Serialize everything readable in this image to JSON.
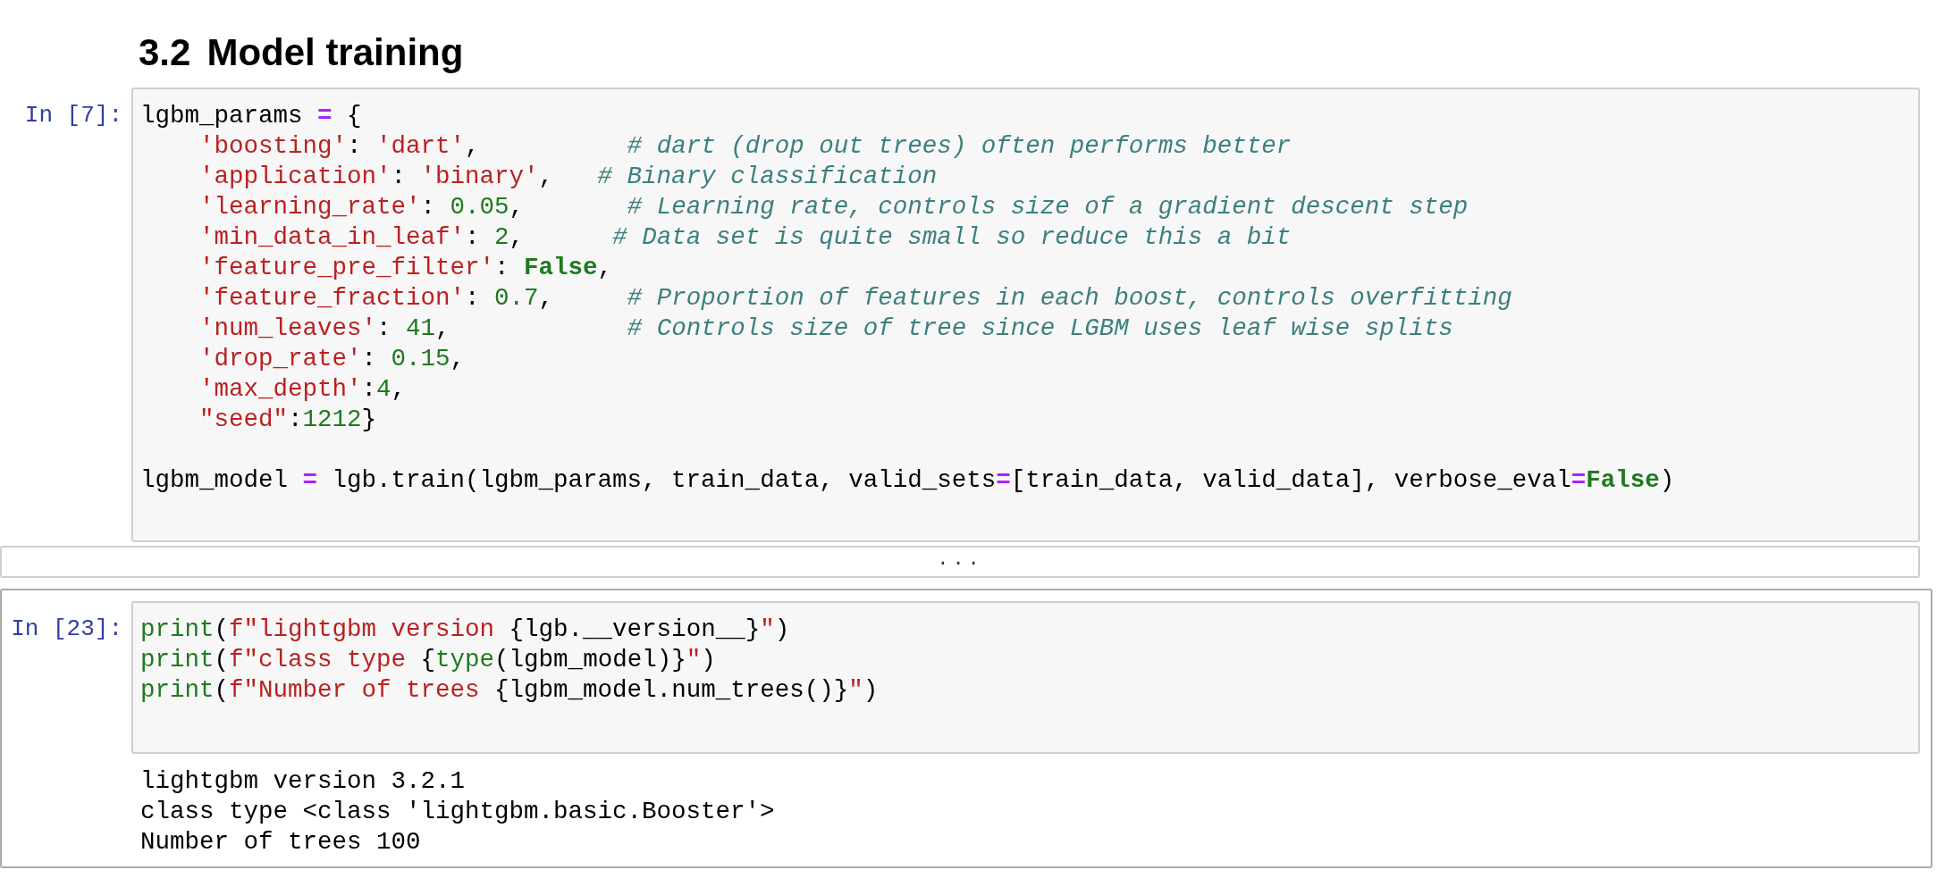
{
  "heading": {
    "number": "3.2",
    "title": "Model training"
  },
  "cells": [
    {
      "prompt": "In [7]:",
      "selected": false,
      "blocks": [
        [
          [
            {
              "t": "lgbm_params ",
              "kind": "plain"
            },
            {
              "t": "=",
              "kind": "op"
            },
            {
              "t": " {",
              "kind": "plain"
            }
          ],
          [
            {
              "t": "    'boosting'",
              "kind": "str"
            },
            {
              "t": ": ",
              "kind": "plain"
            },
            {
              "t": "'dart'",
              "kind": "str"
            },
            {
              "t": ",          ",
              "kind": "plain"
            },
            {
              "t": "# dart (drop out trees) often performs better",
              "kind": "comment"
            }
          ],
          [
            {
              "t": "    'application'",
              "kind": "str"
            },
            {
              "t": ": ",
              "kind": "plain"
            },
            {
              "t": "'binary'",
              "kind": "str"
            },
            {
              "t": ",   ",
              "kind": "plain"
            },
            {
              "t": "# Binary classification",
              "kind": "comment"
            }
          ],
          [
            {
              "t": "    'learning_rate'",
              "kind": "str"
            },
            {
              "t": ": ",
              "kind": "plain"
            },
            {
              "t": "0.05",
              "kind": "num"
            },
            {
              "t": ",       ",
              "kind": "plain"
            },
            {
              "t": "# Learning rate, controls size of a gradient descent step",
              "kind": "comment"
            }
          ],
          [
            {
              "t": "    'min_data_in_leaf'",
              "kind": "str"
            },
            {
              "t": ": ",
              "kind": "plain"
            },
            {
              "t": "2",
              "kind": "num"
            },
            {
              "t": ",      ",
              "kind": "plain"
            },
            {
              "t": "# Data set is quite small so reduce this a bit",
              "kind": "comment"
            }
          ],
          [
            {
              "t": "    'feature_pre_filter'",
              "kind": "str"
            },
            {
              "t": ": ",
              "kind": "plain"
            },
            {
              "t": "False",
              "kind": "kw"
            },
            {
              "t": ",",
              "kind": "plain"
            }
          ],
          [
            {
              "t": "    'feature_fraction'",
              "kind": "str"
            },
            {
              "t": ": ",
              "kind": "plain"
            },
            {
              "t": "0.7",
              "kind": "num"
            },
            {
              "t": ",     ",
              "kind": "plain"
            },
            {
              "t": "# Proportion of features in each boost, controls overfitting",
              "kind": "comment"
            }
          ],
          [
            {
              "t": "    'num_leaves'",
              "kind": "str"
            },
            {
              "t": ": ",
              "kind": "plain"
            },
            {
              "t": "41",
              "kind": "num"
            },
            {
              "t": ",            ",
              "kind": "plain"
            },
            {
              "t": "# Controls size of tree since LGBM uses leaf wise splits",
              "kind": "comment"
            }
          ],
          [
            {
              "t": "    'drop_rate'",
              "kind": "str"
            },
            {
              "t": ": ",
              "kind": "plain"
            },
            {
              "t": "0.15",
              "kind": "num"
            },
            {
              "t": ",",
              "kind": "plain"
            }
          ],
          [
            {
              "t": "    'max_depth'",
              "kind": "str"
            },
            {
              "t": ":",
              "kind": "plain"
            },
            {
              "t": "4",
              "kind": "num"
            },
            {
              "t": ",",
              "kind": "plain"
            }
          ],
          [
            {
              "t": "    \"seed\"",
              "kind": "str"
            },
            {
              "t": ":",
              "kind": "plain"
            },
            {
              "t": "1212",
              "kind": "num"
            },
            {
              "t": "}",
              "kind": "plain"
            }
          ]
        ],
        [
          [
            {
              "t": "lgbm_model ",
              "kind": "plain"
            },
            {
              "t": "=",
              "kind": "op"
            },
            {
              "t": " lgb.train(lgbm_params, train_data, valid_sets",
              "kind": "plain"
            },
            {
              "t": "=",
              "kind": "op"
            },
            {
              "t": "[train_data, valid_data], verbose_eval",
              "kind": "plain"
            },
            {
              "t": "=",
              "kind": "op"
            },
            {
              "t": "False",
              "kind": "kw"
            },
            {
              "t": ")",
              "kind": "plain"
            }
          ]
        ]
      ],
      "collapsed_output": "..."
    },
    {
      "prompt": "In [23]:",
      "selected": true,
      "blocks": [
        [
          [
            {
              "t": "print",
              "kind": "builtin"
            },
            {
              "t": "(",
              "kind": "plain"
            },
            {
              "t": "f\"lightgbm version ",
              "kind": "str"
            },
            {
              "t": "{lgb.__version__}",
              "kind": "plain"
            },
            {
              "t": "\"",
              "kind": "str"
            },
            {
              "t": ")",
              "kind": "plain"
            }
          ],
          [
            {
              "t": "print",
              "kind": "builtin"
            },
            {
              "t": "(",
              "kind": "plain"
            },
            {
              "t": "f\"class type ",
              "kind": "str"
            },
            {
              "t": "{",
              "kind": "plain"
            },
            {
              "t": "type",
              "kind": "builtin"
            },
            {
              "t": "(lgbm_model)}",
              "kind": "plain"
            },
            {
              "t": "\"",
              "kind": "str"
            },
            {
              "t": ")",
              "kind": "plain"
            }
          ],
          [
            {
              "t": "print",
              "kind": "builtin"
            },
            {
              "t": "(",
              "kind": "plain"
            },
            {
              "t": "f\"Number of trees ",
              "kind": "str"
            },
            {
              "t": "{lgbm_model.num_trees()}",
              "kind": "plain"
            },
            {
              "t": "\"",
              "kind": "str"
            },
            {
              "t": ")",
              "kind": "plain"
            }
          ]
        ]
      ],
      "output": [
        "lightgbm version 3.2.1",
        "class type <class 'lightgbm.basic.Booster'>",
        "Number of trees 100"
      ]
    }
  ]
}
